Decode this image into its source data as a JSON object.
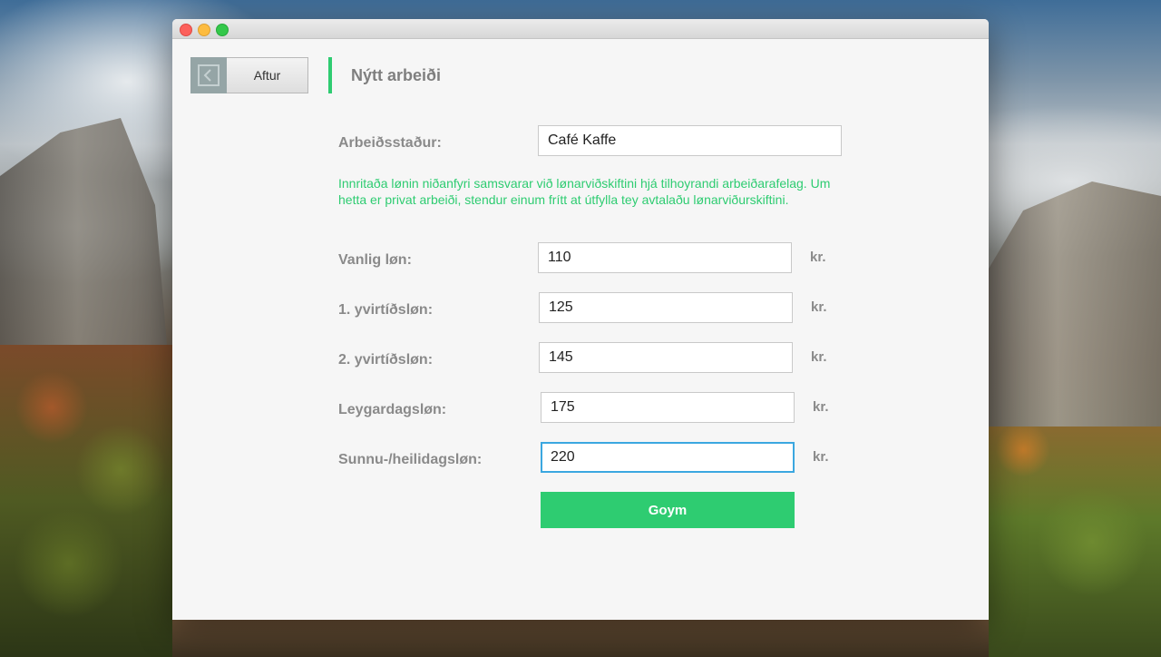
{
  "window": {
    "controls": [
      "close",
      "minimize",
      "maximize"
    ]
  },
  "header": {
    "back_label": "Aftur",
    "back_icon": "chevron-left-icon",
    "title": "Nýtt arbeiði"
  },
  "form": {
    "workplace": {
      "label": "Arbeiðsstaður:",
      "value": "Café Kaffe"
    },
    "info": "Innritaða lønin niðanfyri samsvarar við lønarviðskiftini hjá tilhoyrandi arbeiðarafelag. Um hetta er privat arbeiði, stendur einum frítt at útfylla tey avtalaðu lønarviðurskiftini.",
    "wages": [
      {
        "label": "Vanlig løn:",
        "value": "110",
        "unit": "kr."
      },
      {
        "label": "1. yvirtíðsløn:",
        "value": "125",
        "unit": "kr."
      },
      {
        "label": "2. yvirtíðsløn:",
        "value": "145",
        "unit": "kr."
      },
      {
        "label": "Leygardagsløn:",
        "value": "175",
        "unit": "kr."
      },
      {
        "label": "Sunnu-/heilidagsløn:",
        "value": "220",
        "unit": "kr."
      }
    ],
    "save_label": "Goym"
  },
  "colors": {
    "accent": "#2ecc71",
    "back_icon_bg": "#95a5a6",
    "label": "#8a8a8a",
    "focus": "#3ba7e0"
  }
}
